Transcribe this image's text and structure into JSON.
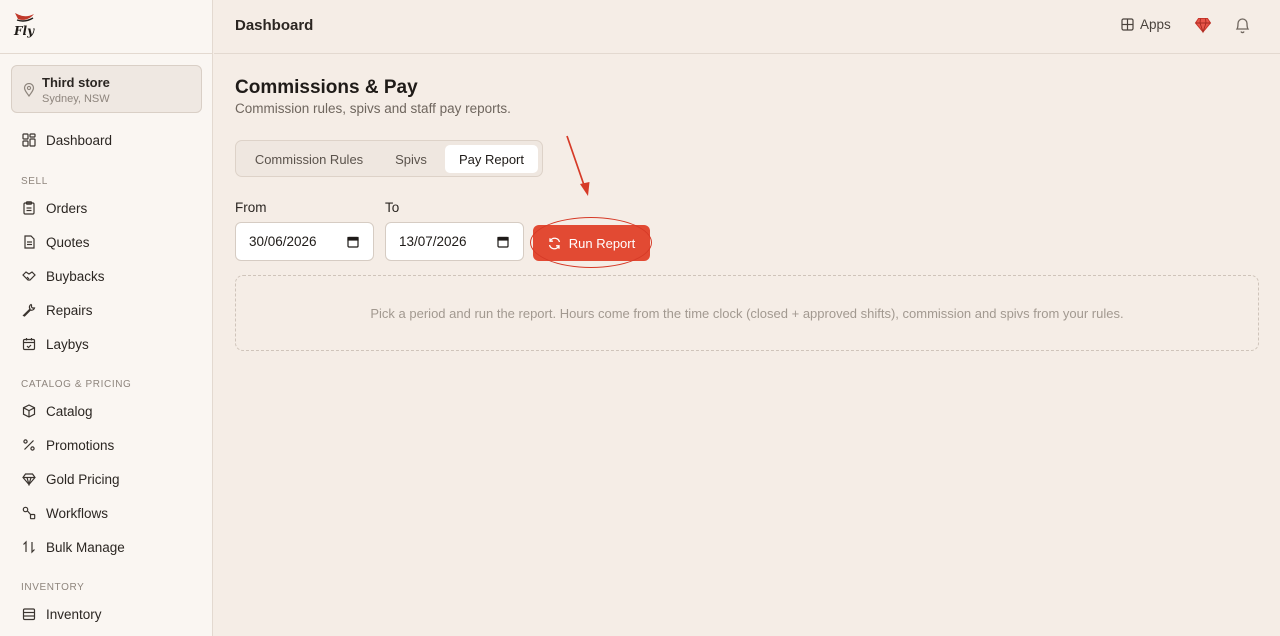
{
  "brand": {
    "logo_text": "Fly"
  },
  "store": {
    "name": "Third store",
    "location": "Sydney, NSW"
  },
  "sidebar": {
    "top_item": {
      "label": "Dashboard",
      "icon": "dashboard-icon"
    },
    "sections": [
      {
        "label": "SELL",
        "items": [
          {
            "label": "Orders",
            "icon": "clipboard-icon"
          },
          {
            "label": "Quotes",
            "icon": "document-icon"
          },
          {
            "label": "Buybacks",
            "icon": "handshake-icon"
          },
          {
            "label": "Repairs",
            "icon": "wrench-icon"
          },
          {
            "label": "Laybys",
            "icon": "calendar-icon"
          }
        ]
      },
      {
        "label": "CATALOG & PRICING",
        "items": [
          {
            "label": "Catalog",
            "icon": "box-icon"
          },
          {
            "label": "Promotions",
            "icon": "percent-icon"
          },
          {
            "label": "Gold Pricing",
            "icon": "diamond-icon"
          },
          {
            "label": "Workflows",
            "icon": "workflow-icon"
          },
          {
            "label": "Bulk Manage",
            "icon": "sort-arrows-icon"
          }
        ]
      },
      {
        "label": "INVENTORY",
        "items": [
          {
            "label": "Inventory",
            "icon": "inventory-icon"
          }
        ]
      }
    ]
  },
  "header": {
    "title": "Dashboard",
    "apps_label": "Apps"
  },
  "page": {
    "title": "Commissions & Pay",
    "subtitle": "Commission rules, spivs and staff pay reports.",
    "tabs": [
      {
        "label": "Commission Rules",
        "active": false
      },
      {
        "label": "Spivs",
        "active": false
      },
      {
        "label": "Pay Report",
        "active": true
      }
    ],
    "from_label": "From",
    "from_value": "30/06/2026",
    "to_label": "To",
    "to_value": "13/07/2026",
    "run_label": "Run Report",
    "empty_message": "Pick a period and run the report. Hours come from the time clock (closed + approved shifts), commission and spivs from your rules."
  },
  "colors": {
    "accent": "#e24a33",
    "background": "#f5ede6",
    "sidebar": "#faf6f2"
  }
}
